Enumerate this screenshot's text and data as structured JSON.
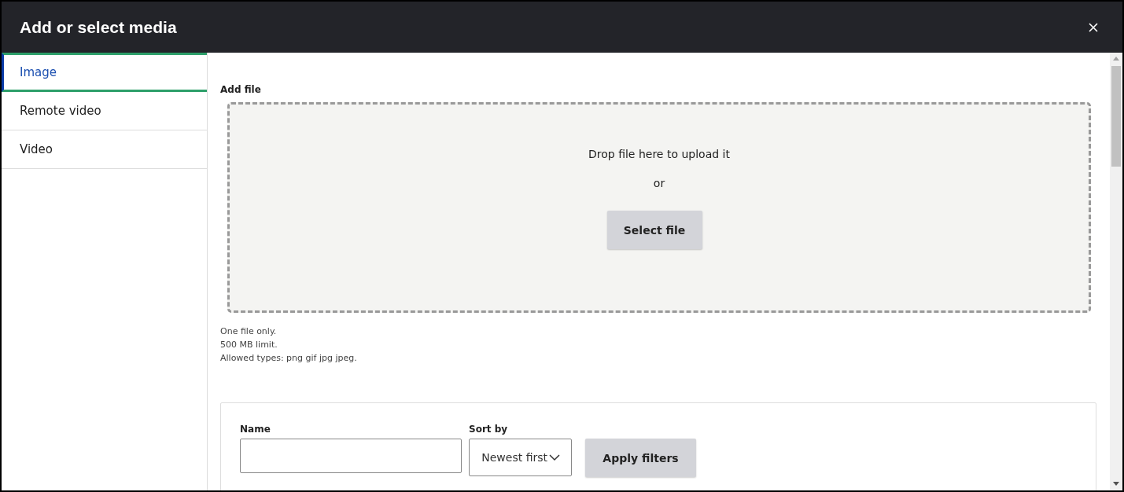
{
  "dialog": {
    "title": "Add or select media"
  },
  "tabs": [
    {
      "label": "Image",
      "selected": true
    },
    {
      "label": "Remote video",
      "selected": false
    },
    {
      "label": "Video",
      "selected": false
    }
  ],
  "upload": {
    "label": "Add file",
    "drop_text": "Drop file here to upload it",
    "or_text": "or",
    "button": "Select file",
    "notes": [
      "One file only.",
      "500 MB limit.",
      "Allowed types: png gif jpg jpeg."
    ]
  },
  "filters": {
    "name_label": "Name",
    "sort_label": "Sort by",
    "sort_value": "Newest first",
    "button": "Apply filters"
  }
}
